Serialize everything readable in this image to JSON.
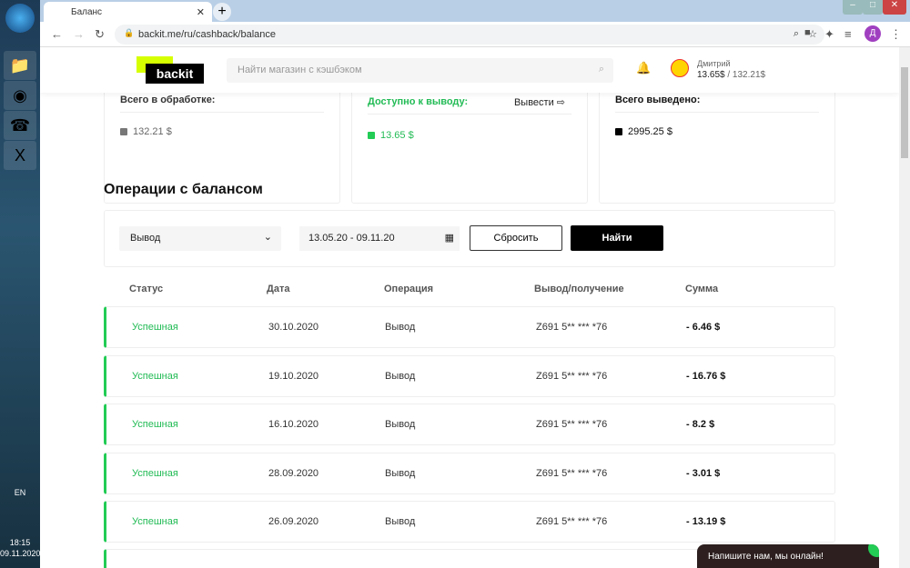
{
  "taskbar": {
    "lang": "EN",
    "time": "18:15",
    "date": "09.11.2020"
  },
  "browser": {
    "active_tab": "Баланс",
    "url": "backit.me/ru/cashback/balance",
    "profile_initial": "Д"
  },
  "header": {
    "logo": "backit",
    "search_placeholder": "Найти магазин с кэшбэком",
    "user_name": "Дмитрий",
    "balance_available": "13.65$",
    "balance_total": "/ 132.21$"
  },
  "cards": [
    {
      "title": "Всего в обработке:",
      "value": "132.21 $",
      "color": "#777777"
    },
    {
      "title": "Доступно к выводу:",
      "value": "13.65 $",
      "color": "#22cc55",
      "action": "Вывести"
    },
    {
      "title": "Всего выведено:",
      "value": "2995.25 $",
      "color": "#000000"
    }
  ],
  "operations": {
    "title": "Операции с балансом",
    "filter_type": "Вывод",
    "date_range": "13.05.20 - 09.11.20",
    "reset_label": "Сбросить",
    "find_label": "Найти",
    "columns": [
      "Статус",
      "Дата",
      "Операция",
      "Вывод/получение",
      "Сумма"
    ],
    "rows": [
      {
        "status": "Успешная",
        "date": "30.10.2020",
        "op": "Вывод",
        "account": "Z691 5** *** *76",
        "sum": "- 6.46 $"
      },
      {
        "status": "Успешная",
        "date": "19.10.2020",
        "op": "Вывод",
        "account": "Z691 5** *** *76",
        "sum": "- 16.76 $"
      },
      {
        "status": "Успешная",
        "date": "16.10.2020",
        "op": "Вывод",
        "account": "Z691 5** *** *76",
        "sum": "- 8.2 $"
      },
      {
        "status": "Успешная",
        "date": "28.09.2020",
        "op": "Вывод",
        "account": "Z691 5** *** *76",
        "sum": "- 3.01 $"
      },
      {
        "status": "Успешная",
        "date": "26.09.2020",
        "op": "Вывод",
        "account": "Z691 5** *** *76",
        "sum": "- 13.19 $"
      }
    ]
  },
  "chat": {
    "label": "Напишите нам, мы онлайн!"
  }
}
